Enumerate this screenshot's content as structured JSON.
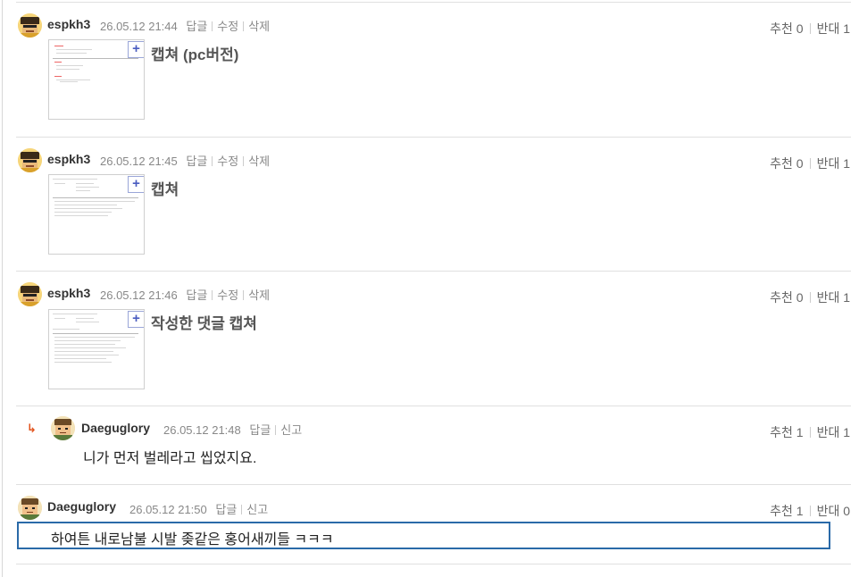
{
  "comments": [
    {
      "author": "espkh3",
      "datetime": "26.05.12 21:44",
      "actions": [
        "답글",
        "수정",
        "삭제"
      ],
      "recommend": "추천 0",
      "oppose": "반대 1",
      "caption": "캡쳐 (pc버전)"
    },
    {
      "author": "espkh3",
      "datetime": "26.05.12 21:45",
      "actions": [
        "답글",
        "수정",
        "삭제"
      ],
      "recommend": "추천 0",
      "oppose": "반대 1",
      "caption": "캡쳐"
    },
    {
      "author": "espkh3",
      "datetime": "26.05.12 21:46",
      "actions": [
        "답글",
        "수정",
        "삭제"
      ],
      "recommend": "추천 0",
      "oppose": "반대 1",
      "caption": "작성한 댓글 캡쳐"
    },
    {
      "author": "Daeguglory",
      "datetime": "26.05.12 21:48",
      "actions": [
        "답글",
        "신고"
      ],
      "recommend": "추천 1",
      "oppose": "반대 1",
      "text": "니가 먼저 벌레라고 씹었지요.",
      "is_reply": true
    },
    {
      "author": "Daeguglory",
      "datetime": "26.05.12 21:50",
      "actions": [
        "답글",
        "신고"
      ],
      "recommend": "추천 1",
      "oppose": "반대 0",
      "text": "하여튼 내로남불 시발 좆같은 홍어새끼들 ㅋㅋㅋ"
    }
  ],
  "icons": {
    "expand": "+",
    "reply_arrow": "↳"
  },
  "colors": {
    "reply_arrow": "#e2531d",
    "edit_box_border": "#2a6aa8",
    "thumbnail_expand": "#4a5cc0"
  }
}
